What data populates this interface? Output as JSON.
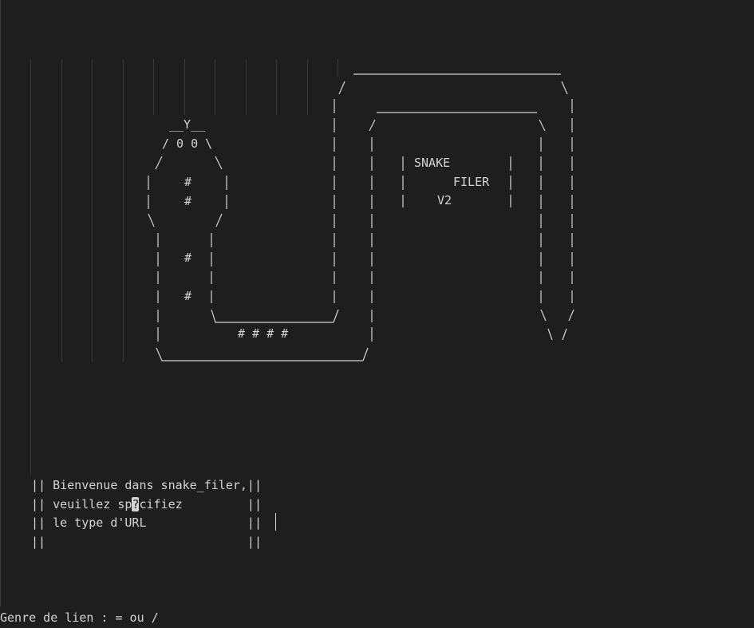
{
  "art": {
    "head_top": "__Y__",
    "eyes": "/ 0 0 \\",
    "hash": "#",
    "tail_hashes": "# # # #",
    "screen_line1": "SNAKE",
    "screen_line2": "FILER",
    "screen_line3": "V2"
  },
  "welcome": {
    "lines": [
      "|| Bienvenue dans snake_filer,||",
      "|| veuillez sp",
      "|| le type d'URL              ||",
      "||                            ||"
    ],
    "line2_tail": "cifiez         ||",
    "replacement_char": "?"
  },
  "prompt": {
    "text": "Genre de lien : = ou /"
  }
}
